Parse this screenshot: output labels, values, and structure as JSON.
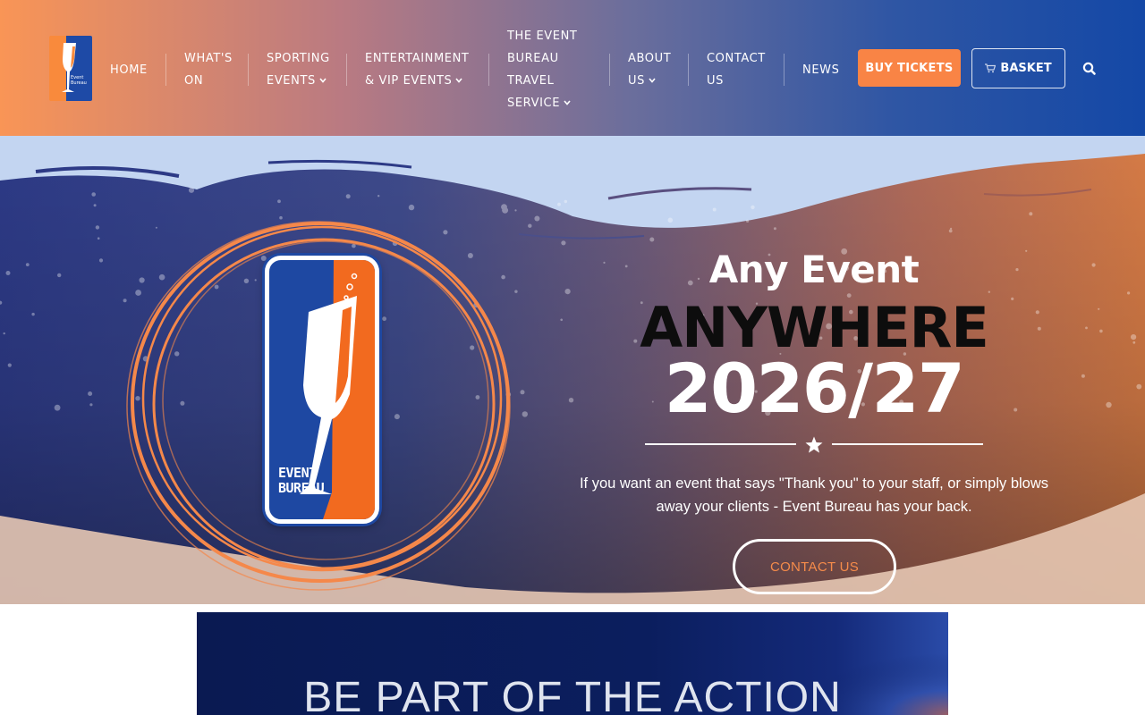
{
  "header": {
    "logo_alt": "Event Bureau",
    "nav": [
      {
        "label_lines": [
          "HOME"
        ],
        "dropdown": false
      },
      {
        "label_lines": [
          "WHAT'S",
          "ON"
        ],
        "dropdown": false
      },
      {
        "label_lines": [
          "SPORTING",
          "EVENTS"
        ],
        "dropdown": true
      },
      {
        "label_lines": [
          "ENTERTAINMENT",
          "& VIP EVENTS"
        ],
        "dropdown": true
      },
      {
        "label_lines": [
          "THE EVENT",
          "BUREAU",
          "TRAVEL",
          "SERVICE"
        ],
        "dropdown": true
      },
      {
        "label_lines": [
          "ABOUT",
          "US"
        ],
        "dropdown": true
      },
      {
        "label_lines": [
          "CONTACT",
          "US"
        ],
        "dropdown": false
      },
      {
        "label_lines": [
          "NEWS"
        ],
        "dropdown": false
      }
    ],
    "buy_tickets_label": "BUY TICKETS",
    "basket_label": "BASKET",
    "basket_icon": "cart-icon",
    "search_icon": "search-icon"
  },
  "hero": {
    "badge_text_line1": "EVENT",
    "badge_text_line2": "BUREAU",
    "heading_small": "Any Event",
    "heading_big": "ANYWHERE",
    "heading_year": "2026/27",
    "divider_icon": "star-icon",
    "tagline": "If you want an event that says \"Thank you\" to your staff, or simply blows away your clients - Event Bureau has your back.",
    "contact_button_label": "CONTACT US"
  },
  "banner": {
    "text": "BE  PART OF THE ACTION"
  },
  "colors": {
    "accent_orange": "#f98445",
    "brand_blue": "#1e48a2",
    "header_gradient_start": "#f99556",
    "header_gradient_end": "#1448a6"
  }
}
